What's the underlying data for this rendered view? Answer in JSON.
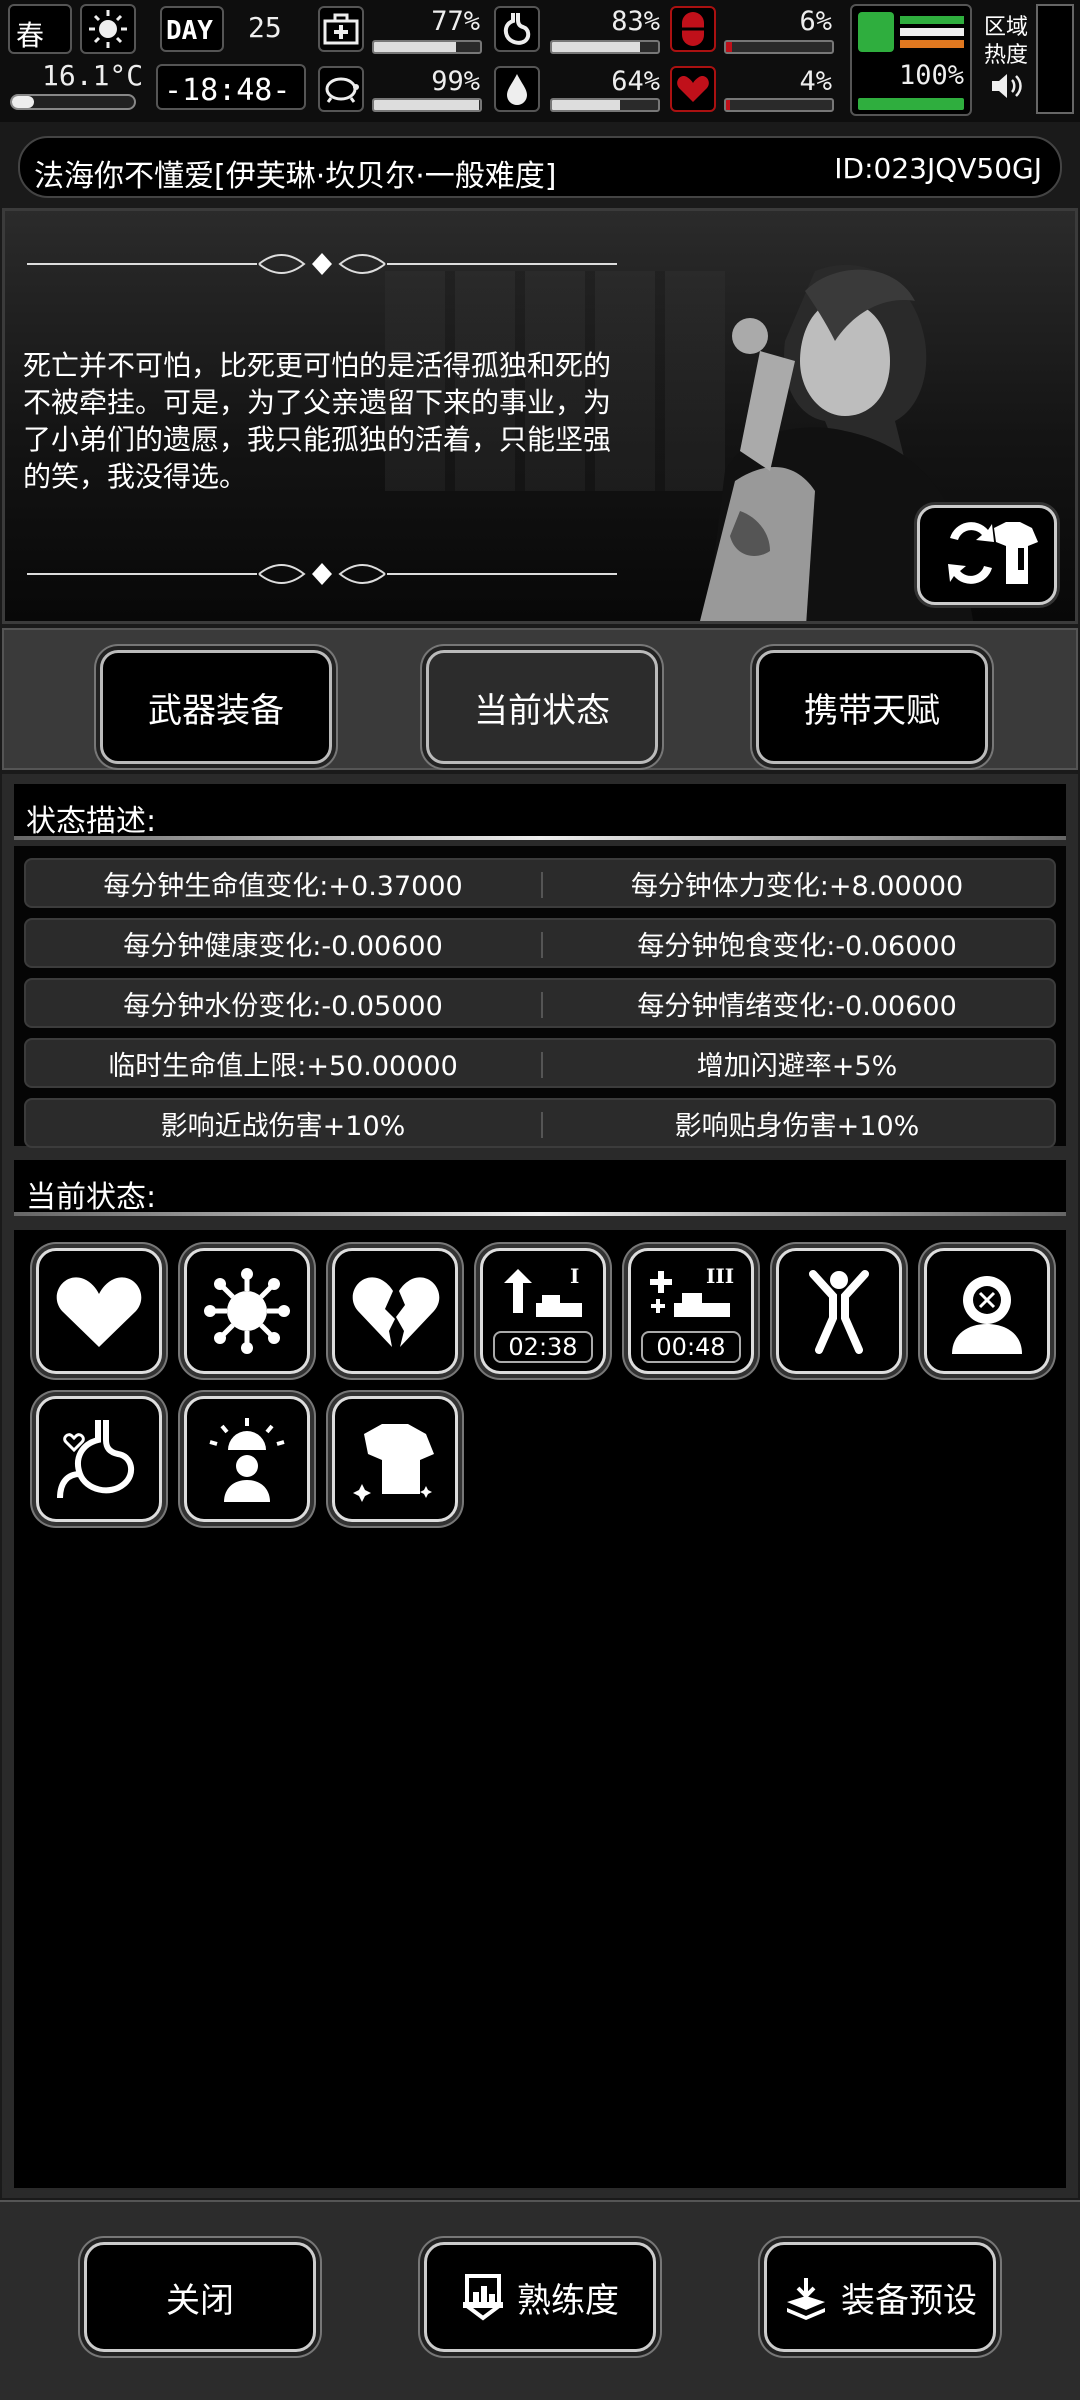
{
  "topbar": {
    "season": "春",
    "weather": "sun-icon",
    "temperature": "16.1°C",
    "day_label": "DAY",
    "day_number": "25",
    "time": "-18:48-",
    "stats": [
      {
        "name": "health-kit",
        "percent": "77%",
        "value": 0.77
      },
      {
        "name": "stomach",
        "percent": "83%",
        "value": 0.83
      },
      {
        "name": "pill",
        "percent": "6%",
        "value": 0.06
      },
      {
        "name": "turtle",
        "percent": "99%",
        "value": 0.99
      },
      {
        "name": "water-drop",
        "percent": "64%",
        "value": 0.64
      },
      {
        "name": "heart",
        "percent": "4%",
        "value": 0.04
      }
    ],
    "stamina_percent": "100%",
    "stamina_value": 1.0,
    "zone_heat_label": "区域热度"
  },
  "header": {
    "character_name": "法海你不懂爱[伊芙琳·坎贝尔·一般难度]",
    "player_id": "ID:023JQV50GJ"
  },
  "story": {
    "quote": "死亡并不可怕，比死更可怕的是活得孤独和死的不被牵挂。可是，为了父亲遗留下来的事业，为了小弟们的遗愿，我只能孤独的活着，只能坚强的笑，我没得选。"
  },
  "tabs": [
    {
      "label": "武器装备",
      "active": false
    },
    {
      "label": "当前状态",
      "active": true
    },
    {
      "label": "携带天赋",
      "active": false
    }
  ],
  "status_desc": {
    "heading": "状态描述:",
    "rows": [
      [
        "每分钟生命值变化:+0.37000",
        "每分钟体力变化:+8.00000"
      ],
      [
        "每分钟健康变化:-0.00600",
        "每分钟饱食变化:-0.06000"
      ],
      [
        "每分钟水份变化:-0.05000",
        "每分钟情绪变化:-0.00600"
      ],
      [
        "临时生命值上限:+50.00000",
        "增加闪避率+5%"
      ],
      [
        "影响近战伤害+10%",
        "影响贴身伤害+10%"
      ]
    ]
  },
  "current_status": {
    "heading": "当前状态:",
    "icons": [
      {
        "name": "heart-icon"
      },
      {
        "name": "virus-icon"
      },
      {
        "name": "broken-heart-icon"
      },
      {
        "name": "level-up-one-icon",
        "timer": "02:38"
      },
      {
        "name": "medical-three-icon",
        "timer": "00:48"
      },
      {
        "name": "stretch-figure-icon"
      },
      {
        "name": "head-mind-icon"
      },
      {
        "name": "stomach-love-icon"
      },
      {
        "name": "alarm-person-icon"
      },
      {
        "name": "shirt-sparkle-icon"
      }
    ]
  },
  "bottom": {
    "close_label": "关闭",
    "proficiency_label": "熟练度",
    "preset_label": "装备预设"
  }
}
